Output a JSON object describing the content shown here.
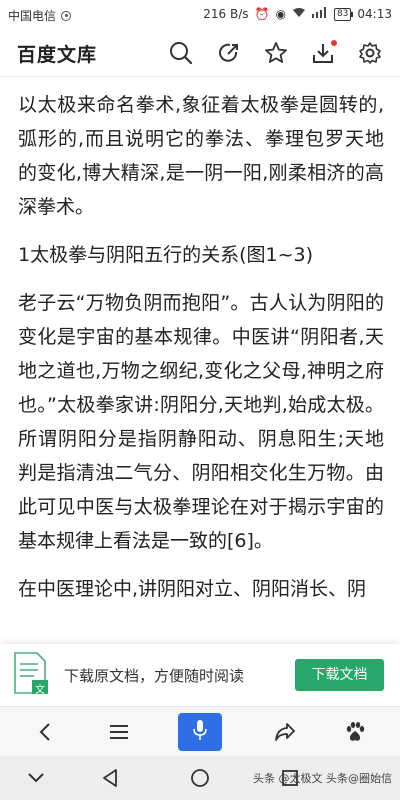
{
  "status_bar": {
    "carrier": "中国电信",
    "speed": "216 B/s",
    "battery": "83",
    "time": "04:13"
  },
  "header": {
    "brand": "百度文库",
    "icons": [
      "search-icon",
      "share-icon",
      "star-icon",
      "download-icon",
      "settings-icon"
    ],
    "accent_color": "#e23b2e"
  },
  "article": {
    "paragraphs": [
      "以太极来命名拳术,象征着太极拳是圆转的,弧形的,而且说明它的拳法、拳理包罗天地的变化,博大精深,是一阴一阳,刚柔相济的高深拳术。",
      "1太极拳与阴阳五行的关系(图1~3)",
      "老子云“万物负阴而抱阳”。古人认为阴阳的变化是宇宙的基本规律。中医讲“阴阳者,天地之道也,万物之纲纪,变化之父母,神明之府也。”太极拳家讲:阴阳分,天地判,始成太极。所谓阴阳分是指阴静阳动、阴息阳生;天地判是指清浊二气分、阴阳相交化生万物。由此可见中医与太极拳理论在对于揭示宇宙的基本规律上看法是一致的[6]。",
      "在中医理论中,讲阴阳对立、阴阳消长、阴"
    ]
  },
  "banner": {
    "text": "下载原文档，方便随时阅读",
    "button_label": "下载文档",
    "button_color": "#27a86a",
    "doc_badge": "文"
  },
  "browser_nav": {
    "icons": [
      "back-icon",
      "menu-icon",
      "microphone-icon",
      "forward-share-icon",
      "baidu-paw-icon"
    ],
    "mic_color": "#2f6fe6"
  },
  "system_nav": {
    "watermark": "头条 @太极文 头条@圈始信"
  }
}
